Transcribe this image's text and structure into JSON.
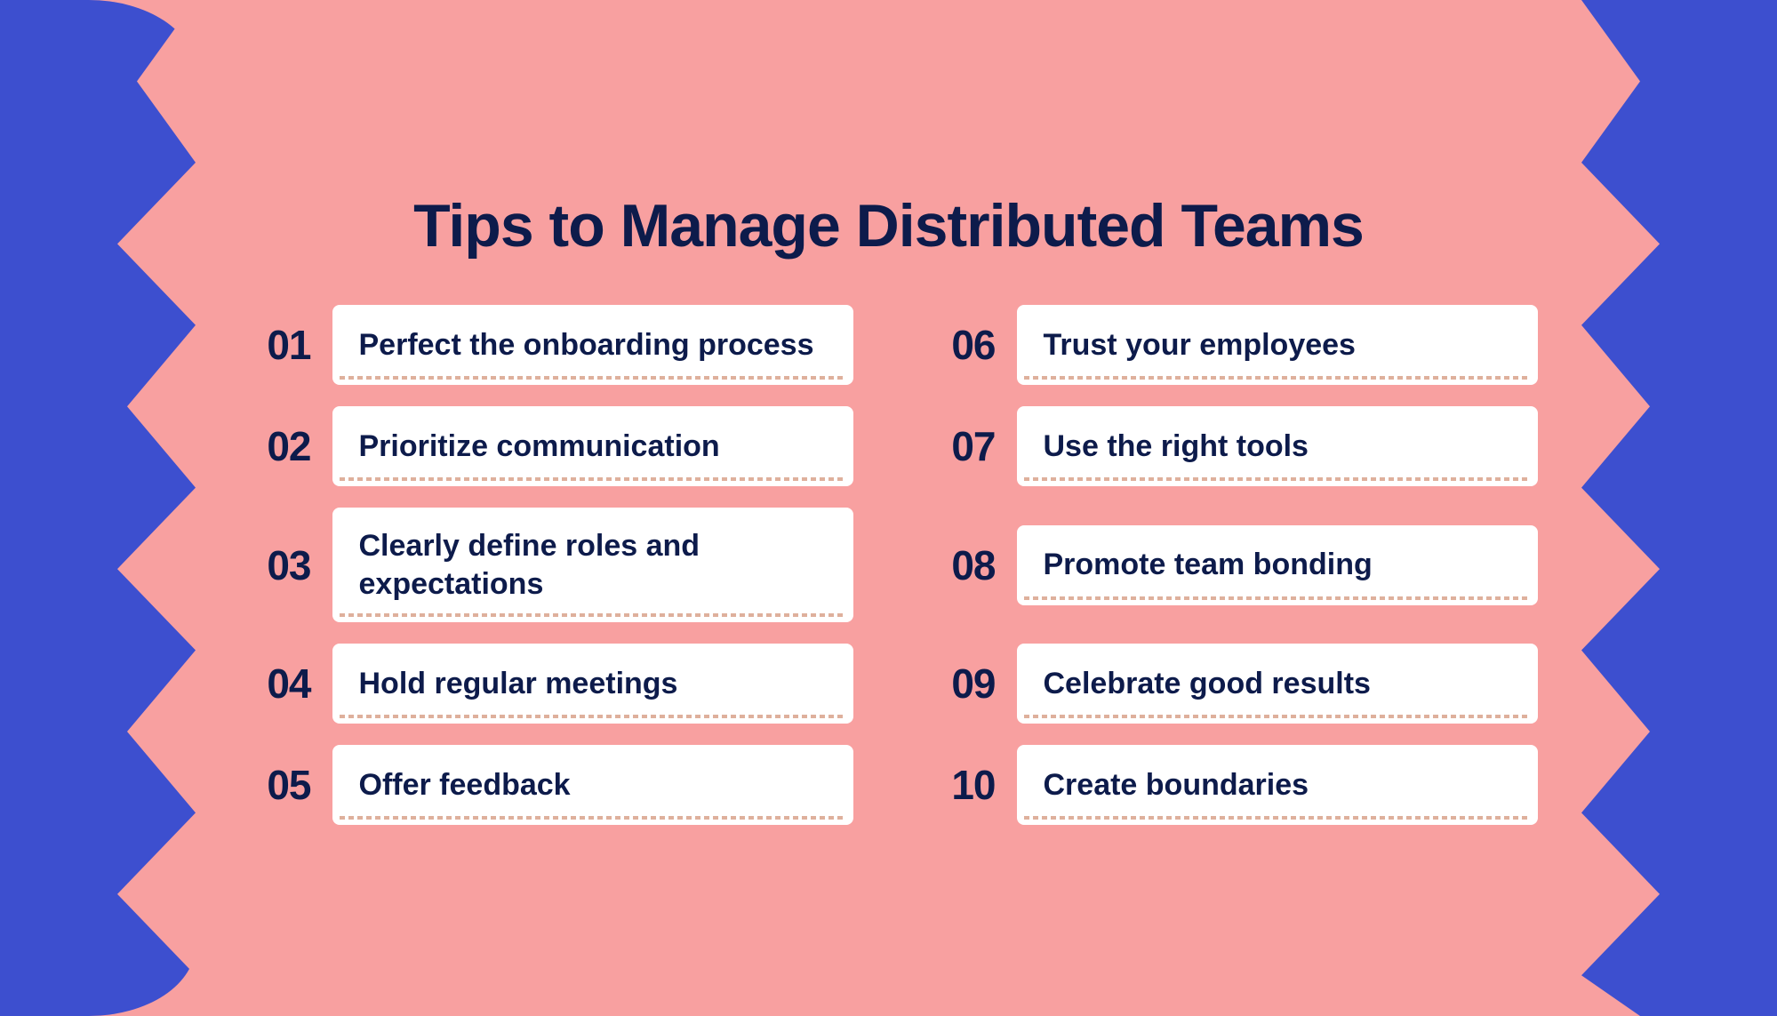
{
  "page": {
    "title": "Tips to Manage Distributed Teams",
    "background_color": "#f8a0a0",
    "accent_color": "#3d4fcf"
  },
  "tips": [
    {
      "number": "01",
      "text": "Perfect the onboarding process"
    },
    {
      "number": "06",
      "text": "Trust your employees"
    },
    {
      "number": "02",
      "text": "Prioritize communication"
    },
    {
      "number": "07",
      "text": "Use the right tools"
    },
    {
      "number": "03",
      "text": "Clearly define roles and expectations"
    },
    {
      "number": "08",
      "text": "Promote team bonding"
    },
    {
      "number": "04",
      "text": "Hold regular meetings"
    },
    {
      "number": "09",
      "text": "Celebrate good results"
    },
    {
      "number": "05",
      "text": "Offer feedback"
    },
    {
      "number": "10",
      "text": "Create boundaries"
    }
  ]
}
